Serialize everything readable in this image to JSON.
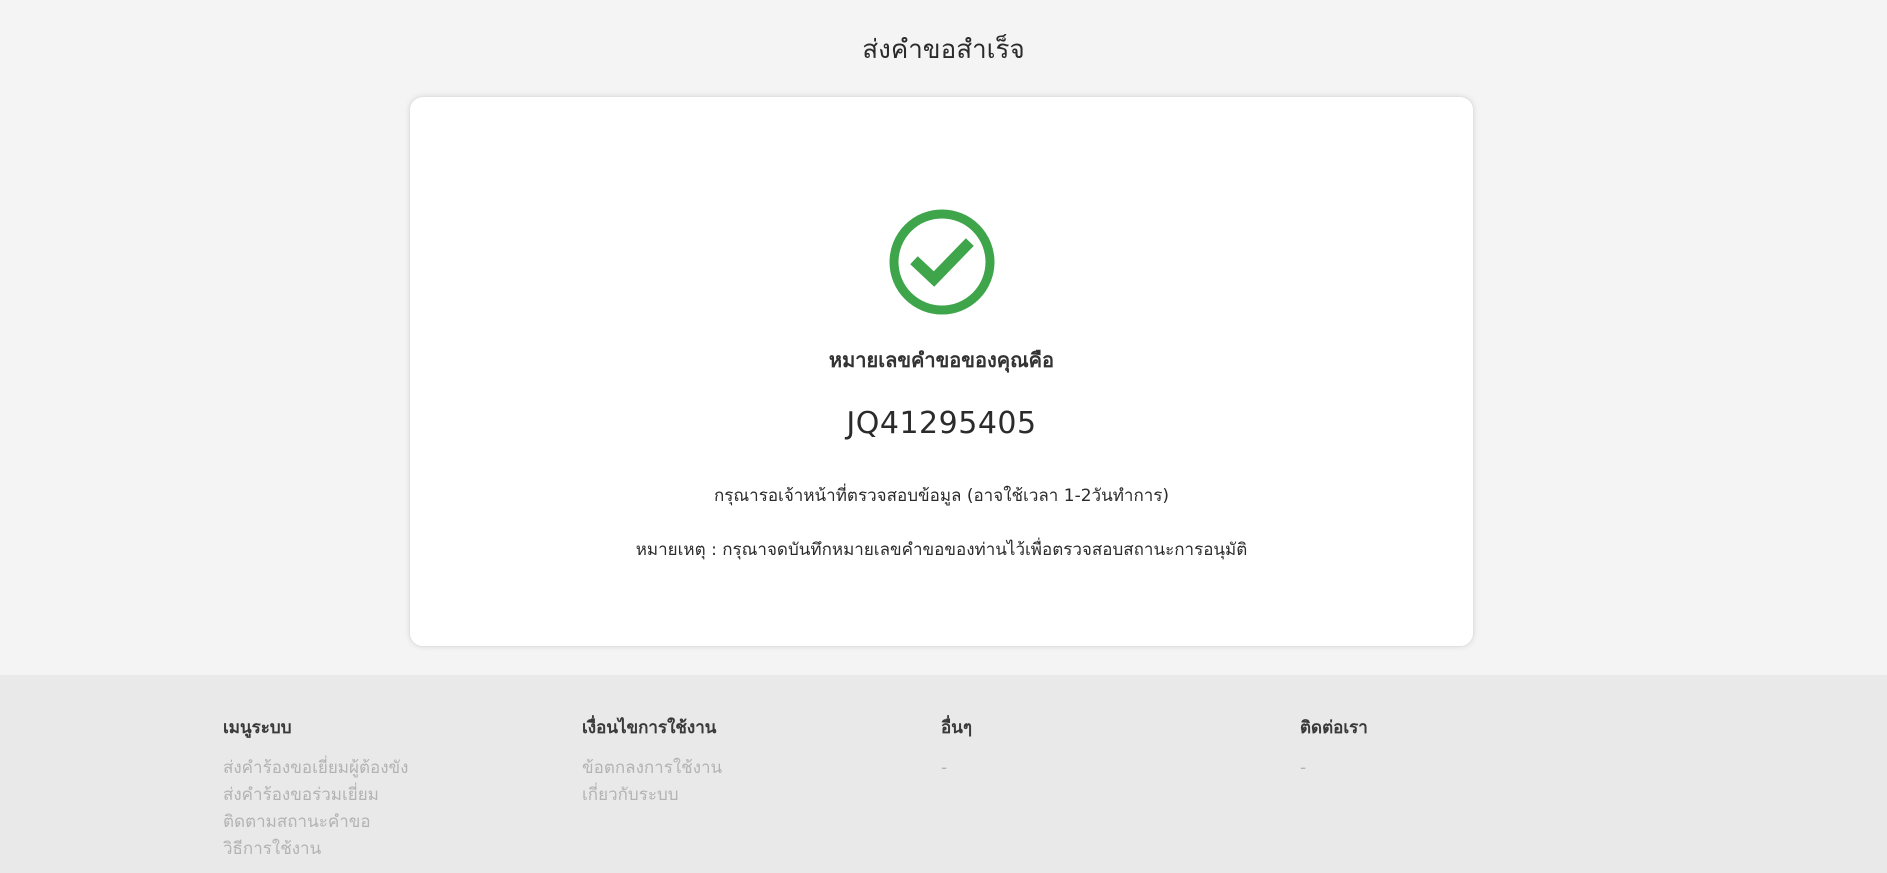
{
  "page": {
    "title": "ส่งคำขอสำเร็จ"
  },
  "card": {
    "label": "หมายเลขคำขอของคุณคือ",
    "request_number": "JQ41295405",
    "wait_text": "กรุณารอเจ้าหน้าที่ตรวจสอบข้อมูล (อาจใช้เวลา 1-2วันทำการ)",
    "note_text": "หมายเหตุ : กรุณาจดบันทึกหมายเลขคำขอของท่านไว้เพื่อตรวจสอบสถานะการอนุมัติ",
    "icon": "check-circle-icon",
    "icon_color": "#3fa54a"
  },
  "footer": {
    "columns": [
      {
        "heading": "เมนูระบบ",
        "items": [
          "ส่งคำร้องขอเยี่ยมผู้ต้องขัง",
          "ส่งคำร้องขอร่วมเยี่ยม",
          "ติดตามสถานะคำขอ",
          "วิธีการใช้งาน"
        ]
      },
      {
        "heading": "เงื่อนไขการใช้งาน",
        "items": [
          "ข้อตกลงการใช้งาน",
          "เกี่ยวกับระบบ"
        ]
      },
      {
        "heading": "อื่นๆ",
        "items": [
          "-"
        ]
      },
      {
        "heading": "ติดต่อเรา",
        "items": [
          "-"
        ]
      }
    ]
  }
}
